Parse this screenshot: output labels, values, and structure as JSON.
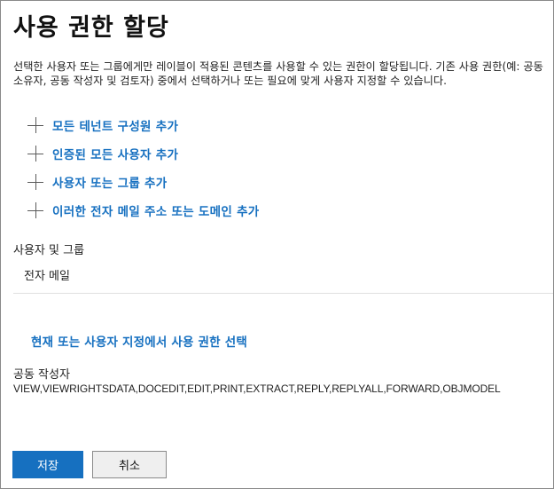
{
  "dialog": {
    "title": "사용 권한 할당",
    "description": "선택한 사용자 또는 그룹에게만 레이블이 적용된 콘텐츠를 사용할 수 있는 권한이 할당됩니다. 기존 사용 권한(예: 공동 소유자, 공동 작성자 및 검토자) 중에서 선택하거나 또는 필요에 맞게 사용자 지정할 수 있습니다."
  },
  "add_options": [
    {
      "label": "모든 테넌트 구성원 추가",
      "icon": "plus-icon"
    },
    {
      "label": "인증된 모든 사용자 추가",
      "icon": "plus-icon"
    },
    {
      "label": "사용자 또는 그룹 추가",
      "icon": "plus-icon"
    },
    {
      "label": "이러한 전자 메일 주소 또는 도메인 추가",
      "icon": "plus-icon"
    }
  ],
  "users_section": {
    "label": "사용자 및 그룹",
    "column_header": "전자 메일"
  },
  "permissions": {
    "choose_link": "현재 또는 사용자 지정에서 사용 권한 선택",
    "level": "공동 작성자",
    "rights": "VIEW,VIEWRIGHTSDATA,DOCEDIT,EDIT,PRINT,EXTRACT,REPLY,REPLYALL,FORWARD,OBJMODEL"
  },
  "buttons": {
    "save": "저장",
    "cancel": "취소"
  },
  "colors": {
    "accent": "#1670c0",
    "text": "#1b1b1b",
    "border": "#8a8a8a"
  }
}
